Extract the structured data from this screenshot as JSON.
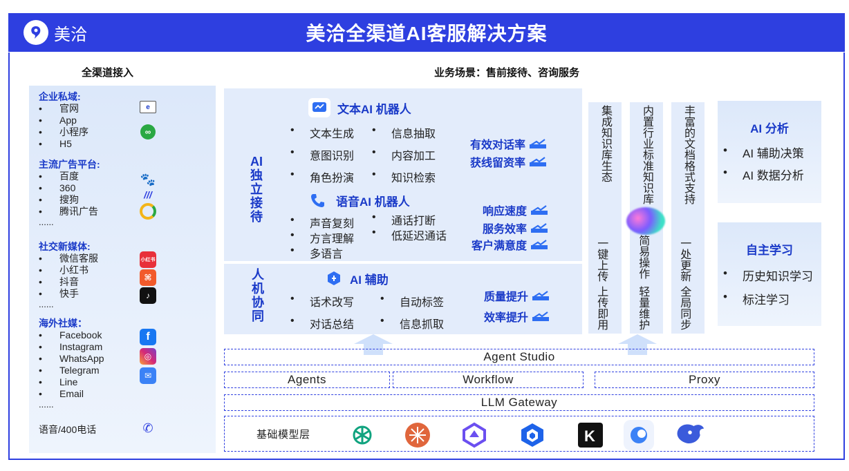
{
  "header": {
    "brand": "美洽",
    "title": "美洽全渠道AI客服解决方案"
  },
  "sections": {
    "channels": "全渠道接入",
    "scenario": "业务场景：售前接待、咨询服务"
  },
  "channels": {
    "enterprise": {
      "title": "企业私域:",
      "items": [
        "官网",
        "App",
        "小程序",
        "H5"
      ]
    },
    "ads": {
      "title": "主流广告平台:",
      "items": [
        "百度",
        "360",
        "搜狗",
        "腾讯广告"
      ],
      "more": "......"
    },
    "social": {
      "title": "社交新媒体:",
      "items": [
        "微信客服",
        "小红书",
        "抖音",
        "快手"
      ],
      "more": "......"
    },
    "overseas": {
      "title": "海外社媒：",
      "items": [
        "Facebook",
        "Instagram",
        "WhatsApp",
        "Telegram",
        "Line",
        "Email"
      ],
      "more": "......"
    },
    "phone": "语音/400电话",
    "icons": [
      "browser-icon",
      "mini-program-icon",
      "baidu-icon",
      "360-icon",
      "sogou-icon",
      "tencent-ads-icon",
      "xiaohongshu-icon",
      "kuaishou-icon",
      "douyin-icon",
      "facebook-icon",
      "instagram-icon",
      "email-icon",
      "phone-icon"
    ]
  },
  "ai_reception": {
    "label": [
      "AI",
      "独",
      "立",
      "接",
      "待"
    ],
    "text_robot": {
      "title": "文本AI 机器人",
      "items": [
        "文本生成",
        "信息抽取",
        "意图识别",
        "内容加工",
        "角色扮演",
        "知识检索"
      ]
    },
    "voice_robot": {
      "title": "语音AI 机器人",
      "items": [
        "声音复刻",
        "通话打断",
        "方言理解",
        "低延迟通话",
        "多语言"
      ]
    },
    "metrics": [
      "有效对话率",
      "获线留资率",
      "响应速度",
      "服务效率",
      "客户满意度"
    ]
  },
  "human_collab": {
    "label": [
      "人",
      "机",
      "协",
      "同"
    ],
    "title": "AI 辅助",
    "items": [
      "话术改写",
      "自动标签",
      "对话总结",
      "信息抓取"
    ],
    "metrics": [
      "质量提升",
      "效率提升"
    ]
  },
  "columns": [
    {
      "top": "集成知识库生态",
      "bottom1": "一键上传",
      "bottom2": "上传即用"
    },
    {
      "top": "内置行业标准知识库",
      "bottom1": "简易操作",
      "bottom2": "轻量维护"
    },
    {
      "top": "丰富的文档格式支持",
      "bottom1": "一处更新",
      "bottom2": "全局同步"
    }
  ],
  "analysis": {
    "title": "AI 分析",
    "items": [
      "AI 辅助决策",
      "AI 数据分析"
    ]
  },
  "learning": {
    "title": "自主学习",
    "items": [
      "历史知识学习",
      "标注学习"
    ]
  },
  "platform": {
    "studio": "Agent  Studio",
    "agents": "Agents",
    "workflow": "Workflow",
    "proxy": "Proxy",
    "gateway": "LLM Gateway",
    "base": "基础模型层",
    "models": [
      "openai-icon",
      "claude-icon",
      "tongyi-icon",
      "deepseek-icon",
      "kimi-icon",
      "doubao-icon",
      "deepseek-whale-icon"
    ]
  },
  "colors": {
    "primary": "#2e3fe0",
    "accent": "#1a3ac8",
    "panel": "#e3ecfb"
  }
}
